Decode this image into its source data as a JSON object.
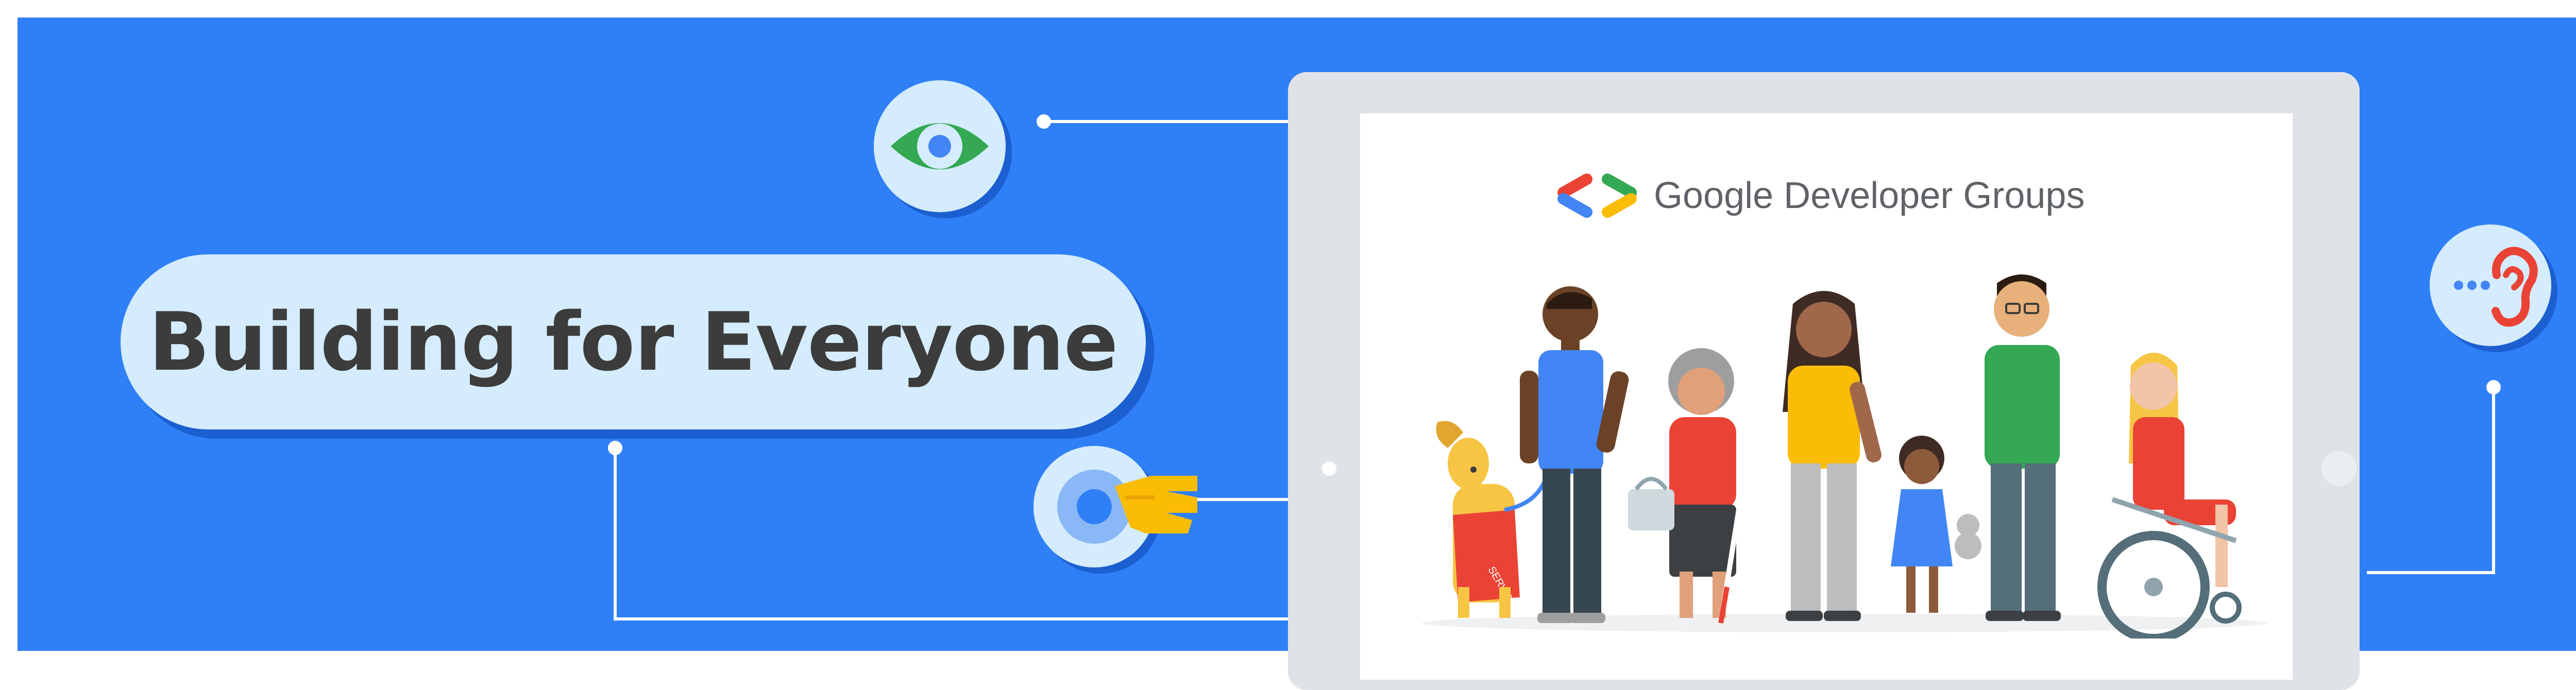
{
  "banner": {
    "title": "Building for Everyone",
    "background_color": "#2f80f7",
    "pill_color": "#d4ecfd"
  },
  "tablet": {
    "brand_name": "Google Developer Groups",
    "brand_logo_colors": [
      "#ea4335",
      "#4285f4",
      "#34a853",
      "#fbbc04"
    ]
  },
  "icons": [
    "eye-icon",
    "touch-hand-icon",
    "ear-icon"
  ],
  "illustration": {
    "figures": [
      "service-dog",
      "man",
      "elderly-woman-with-cane",
      "woman",
      "girl-with-teddy",
      "man-with-glasses",
      "woman-in-wheelchair"
    ],
    "dog_vest_text": "SERVICE"
  }
}
